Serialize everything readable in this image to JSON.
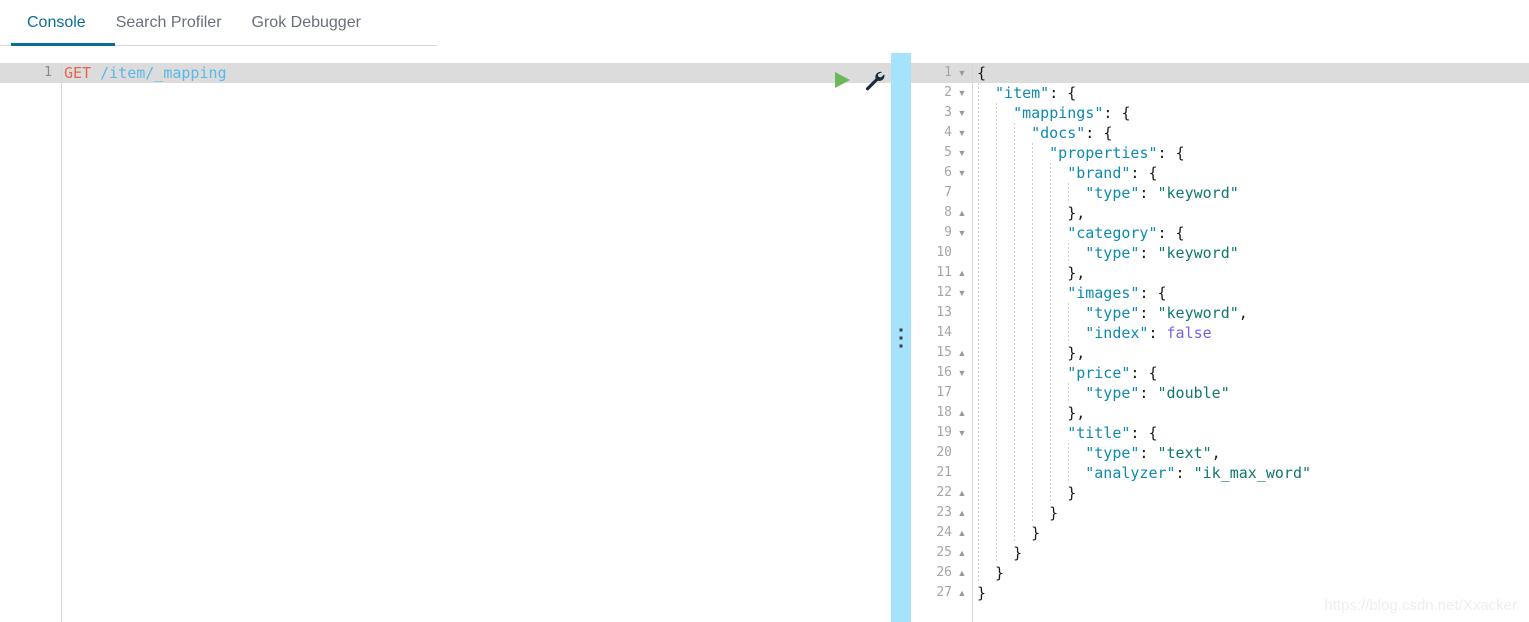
{
  "tabs": [
    {
      "label": "Console",
      "active": true
    },
    {
      "label": "Search Profiler",
      "active": false
    },
    {
      "label": "Grok Debugger",
      "active": false
    }
  ],
  "colors": {
    "accent": "#0a6e9c",
    "splitter": "#a4e3fb",
    "active_line": "#dcdcdc",
    "method": "#e7664c",
    "path": "#5bb8e8",
    "json_key": "#0f8baf",
    "json_string": "#10786f",
    "json_boolean": "#7b61e8",
    "play_icon": "#6db85c",
    "wrench_icon": "#1d2b3a"
  },
  "editor": {
    "line_number": "1",
    "method": "GET",
    "path": "/item/_mapping",
    "run_icon": "play-icon",
    "settings_icon": "wrench-icon"
  },
  "splitter": {
    "icon": "drag-grip-icon"
  },
  "response": {
    "lines": [
      {
        "n": "1",
        "fold": "down",
        "indent": 0,
        "tokens": [
          {
            "t": "punc",
            "v": "{"
          }
        ]
      },
      {
        "n": "2",
        "fold": "down",
        "indent": 1,
        "tokens": [
          {
            "t": "key",
            "v": "\"item\""
          },
          {
            "t": "punc",
            "v": ": {"
          }
        ]
      },
      {
        "n": "3",
        "fold": "down",
        "indent": 2,
        "tokens": [
          {
            "t": "key",
            "v": "\"mappings\""
          },
          {
            "t": "punc",
            "v": ": {"
          }
        ]
      },
      {
        "n": "4",
        "fold": "down",
        "indent": 3,
        "tokens": [
          {
            "t": "key",
            "v": "\"docs\""
          },
          {
            "t": "punc",
            "v": ": {"
          }
        ]
      },
      {
        "n": "5",
        "fold": "down",
        "indent": 4,
        "tokens": [
          {
            "t": "key",
            "v": "\"properties\""
          },
          {
            "t": "punc",
            "v": ": {"
          }
        ]
      },
      {
        "n": "6",
        "fold": "down",
        "indent": 5,
        "tokens": [
          {
            "t": "key",
            "v": "\"brand\""
          },
          {
            "t": "punc",
            "v": ": {"
          }
        ]
      },
      {
        "n": "7",
        "fold": "",
        "indent": 6,
        "tokens": [
          {
            "t": "key",
            "v": "\"type\""
          },
          {
            "t": "punc",
            "v": ": "
          },
          {
            "t": "str",
            "v": "\"keyword\""
          }
        ]
      },
      {
        "n": "8",
        "fold": "up",
        "indent": 5,
        "tokens": [
          {
            "t": "punc",
            "v": "},"
          }
        ]
      },
      {
        "n": "9",
        "fold": "down",
        "indent": 5,
        "tokens": [
          {
            "t": "key",
            "v": "\"category\""
          },
          {
            "t": "punc",
            "v": ": {"
          }
        ]
      },
      {
        "n": "10",
        "fold": "",
        "indent": 6,
        "tokens": [
          {
            "t": "key",
            "v": "\"type\""
          },
          {
            "t": "punc",
            "v": ": "
          },
          {
            "t": "str",
            "v": "\"keyword\""
          }
        ]
      },
      {
        "n": "11",
        "fold": "up",
        "indent": 5,
        "tokens": [
          {
            "t": "punc",
            "v": "},"
          }
        ]
      },
      {
        "n": "12",
        "fold": "down",
        "indent": 5,
        "tokens": [
          {
            "t": "key",
            "v": "\"images\""
          },
          {
            "t": "punc",
            "v": ": {"
          }
        ]
      },
      {
        "n": "13",
        "fold": "",
        "indent": 6,
        "tokens": [
          {
            "t": "key",
            "v": "\"type\""
          },
          {
            "t": "punc",
            "v": ": "
          },
          {
            "t": "str",
            "v": "\"keyword\""
          },
          {
            "t": "punc",
            "v": ","
          }
        ]
      },
      {
        "n": "14",
        "fold": "",
        "indent": 6,
        "tokens": [
          {
            "t": "key",
            "v": "\"index\""
          },
          {
            "t": "punc",
            "v": ": "
          },
          {
            "t": "bool",
            "v": "false"
          }
        ]
      },
      {
        "n": "15",
        "fold": "up",
        "indent": 5,
        "tokens": [
          {
            "t": "punc",
            "v": "},"
          }
        ]
      },
      {
        "n": "16",
        "fold": "down",
        "indent": 5,
        "tokens": [
          {
            "t": "key",
            "v": "\"price\""
          },
          {
            "t": "punc",
            "v": ": {"
          }
        ]
      },
      {
        "n": "17",
        "fold": "",
        "indent": 6,
        "tokens": [
          {
            "t": "key",
            "v": "\"type\""
          },
          {
            "t": "punc",
            "v": ": "
          },
          {
            "t": "str",
            "v": "\"double\""
          }
        ]
      },
      {
        "n": "18",
        "fold": "up",
        "indent": 5,
        "tokens": [
          {
            "t": "punc",
            "v": "},"
          }
        ]
      },
      {
        "n": "19",
        "fold": "down",
        "indent": 5,
        "tokens": [
          {
            "t": "key",
            "v": "\"title\""
          },
          {
            "t": "punc",
            "v": ": {"
          }
        ]
      },
      {
        "n": "20",
        "fold": "",
        "indent": 6,
        "tokens": [
          {
            "t": "key",
            "v": "\"type\""
          },
          {
            "t": "punc",
            "v": ": "
          },
          {
            "t": "str",
            "v": "\"text\""
          },
          {
            "t": "punc",
            "v": ","
          }
        ]
      },
      {
        "n": "21",
        "fold": "",
        "indent": 6,
        "tokens": [
          {
            "t": "key",
            "v": "\"analyzer\""
          },
          {
            "t": "punc",
            "v": ": "
          },
          {
            "t": "str",
            "v": "\"ik_max_word\""
          }
        ]
      },
      {
        "n": "22",
        "fold": "up",
        "indent": 5,
        "tokens": [
          {
            "t": "punc",
            "v": "}"
          }
        ]
      },
      {
        "n": "23",
        "fold": "up",
        "indent": 4,
        "tokens": [
          {
            "t": "punc",
            "v": "}"
          }
        ]
      },
      {
        "n": "24",
        "fold": "up",
        "indent": 3,
        "tokens": [
          {
            "t": "punc",
            "v": "}"
          }
        ]
      },
      {
        "n": "25",
        "fold": "up",
        "indent": 2,
        "tokens": [
          {
            "t": "punc",
            "v": "}"
          }
        ]
      },
      {
        "n": "26",
        "fold": "up",
        "indent": 1,
        "tokens": [
          {
            "t": "punc",
            "v": "}"
          }
        ]
      },
      {
        "n": "27",
        "fold": "up",
        "indent": 0,
        "tokens": [
          {
            "t": "punc",
            "v": "}"
          }
        ]
      }
    ]
  },
  "watermark": {
    "text": "https://blog.csdn.net/Xxacker"
  }
}
